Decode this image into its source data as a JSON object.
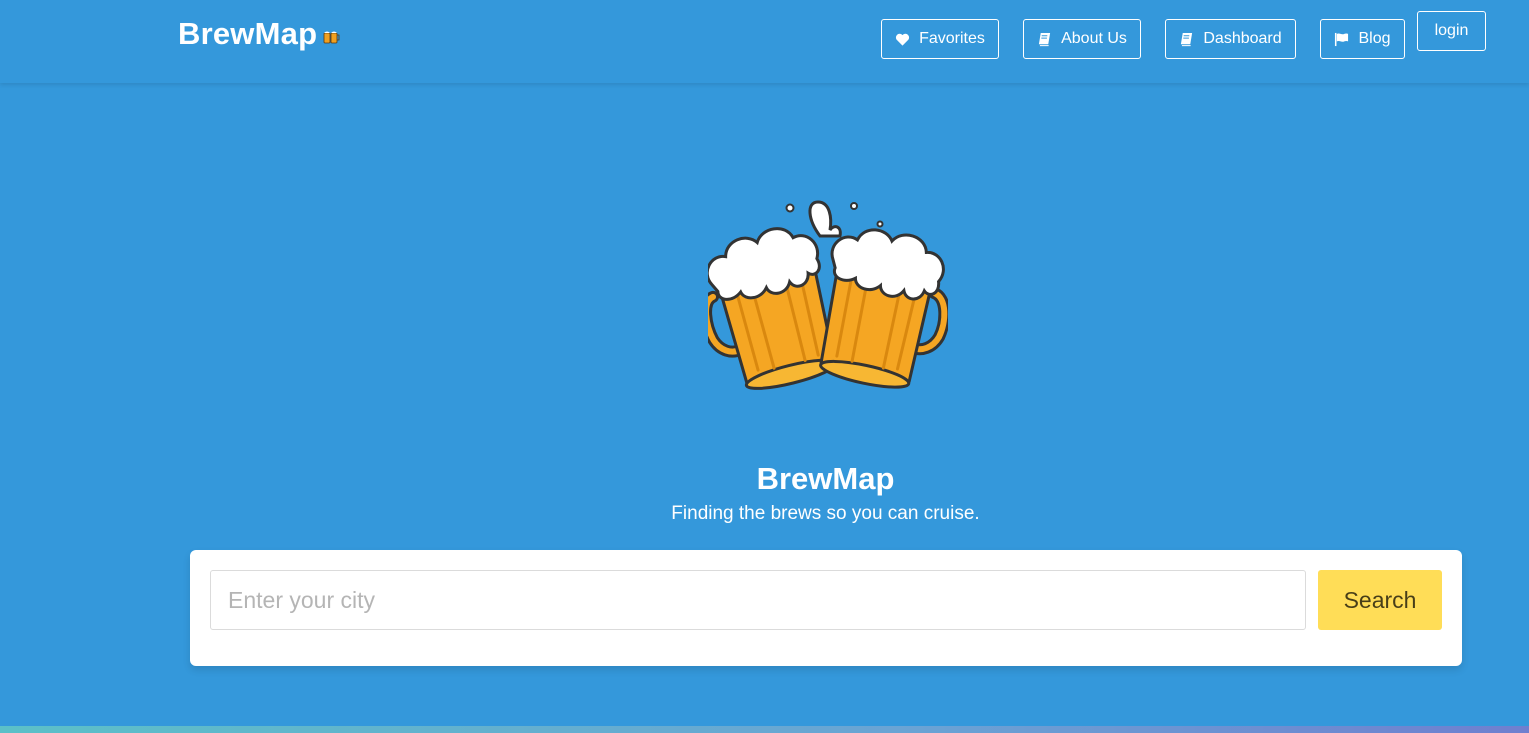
{
  "brand": {
    "name": "BrewMap",
    "emoji_icon": "beer-mugs-icon"
  },
  "nav": {
    "favorites": {
      "label": "Favorites",
      "icon": "heart-icon"
    },
    "about": {
      "label": "About Us",
      "icon": "book-icon"
    },
    "dashboard": {
      "label": "Dashboard",
      "icon": "book-icon"
    },
    "blog": {
      "label": "Blog",
      "icon": "flag-icon"
    },
    "login": {
      "label": "login"
    }
  },
  "hero": {
    "logo_icon": "clinking-beer-mugs-icon",
    "title": "BrewMap",
    "subtitle": "Finding the brews so you can cruise."
  },
  "search": {
    "placeholder": "Enter your city",
    "value": "",
    "button_label": "Search"
  },
  "colors": {
    "background": "#3498db",
    "search_button": "#ffdd57",
    "card": "#ffffff"
  }
}
